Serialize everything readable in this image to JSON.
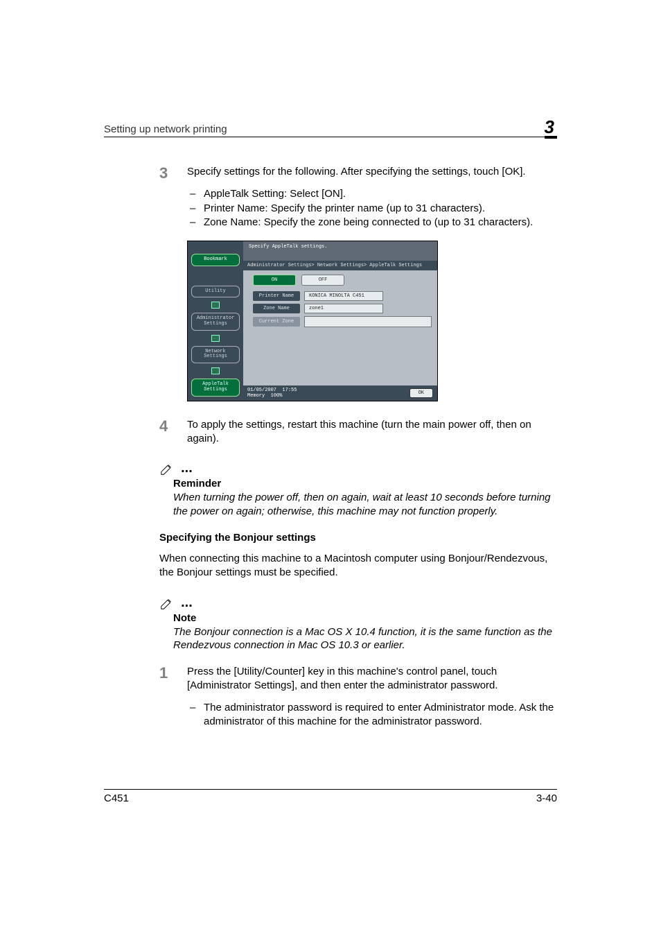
{
  "header": {
    "title": "Setting up network printing",
    "chapter": "3"
  },
  "step3": {
    "num": "3",
    "text": "Specify settings for the following. After specifying the settings, touch [OK].",
    "b1": "AppleTalk Setting: Select [ON].",
    "b2": "Printer Name: Specify the printer name (up to 31 characters).",
    "b3": "Zone Name: Specify the zone being connected to (up to 31 characters)."
  },
  "screenshot": {
    "side": {
      "bookmark": "Bookmark",
      "utility": "Utility",
      "admin": "Administrator Settings",
      "network": "Network Settings",
      "apptalk": "AppleTalk Settings"
    },
    "top": "Specify AppleTalk settings.",
    "breadcrumb": "Administrator Settings> Network Settings> AppleTalk Settings",
    "on": "ON",
    "off": "OFF",
    "printer_label": "Printer Name",
    "printer_value": "KONICA MINOLTA C451",
    "zone_label": "Zone Name",
    "zone_value": "zone1",
    "current_zone": "Current Zone",
    "date": "01/05/2007",
    "time": "17:55",
    "mem": "Memory",
    "mempct": "100%",
    "ok": "OK"
  },
  "step4": {
    "num": "4",
    "text": "To apply the settings, restart this machine (turn the main power off, then on again)."
  },
  "reminder": {
    "label": "Reminder",
    "body": "When turning the power off, then on again, wait at least 10 seconds before turning the power on again; otherwise, this machine may not function properly."
  },
  "section2": {
    "title": "Specifying the Bonjour settings",
    "para": "When connecting this machine to a Macintosh computer using Bonjour/Rendezvous, the Bonjour settings must be specified."
  },
  "note": {
    "label": "Note",
    "body": "The Bonjour connection is a Mac OS X 10.4 function, it is the same function as the Rendezvous connection in Mac OS 10.3 or earlier."
  },
  "step1": {
    "num": "1",
    "text": "Press the [Utility/Counter] key in this machine's control panel, touch [Administrator Settings], and then enter the administrator password.",
    "b1": "The administrator password is required to enter Administrator mode. Ask the administrator of this machine for the administrator password."
  },
  "footer": {
    "left": "C451",
    "right": "3-40"
  }
}
